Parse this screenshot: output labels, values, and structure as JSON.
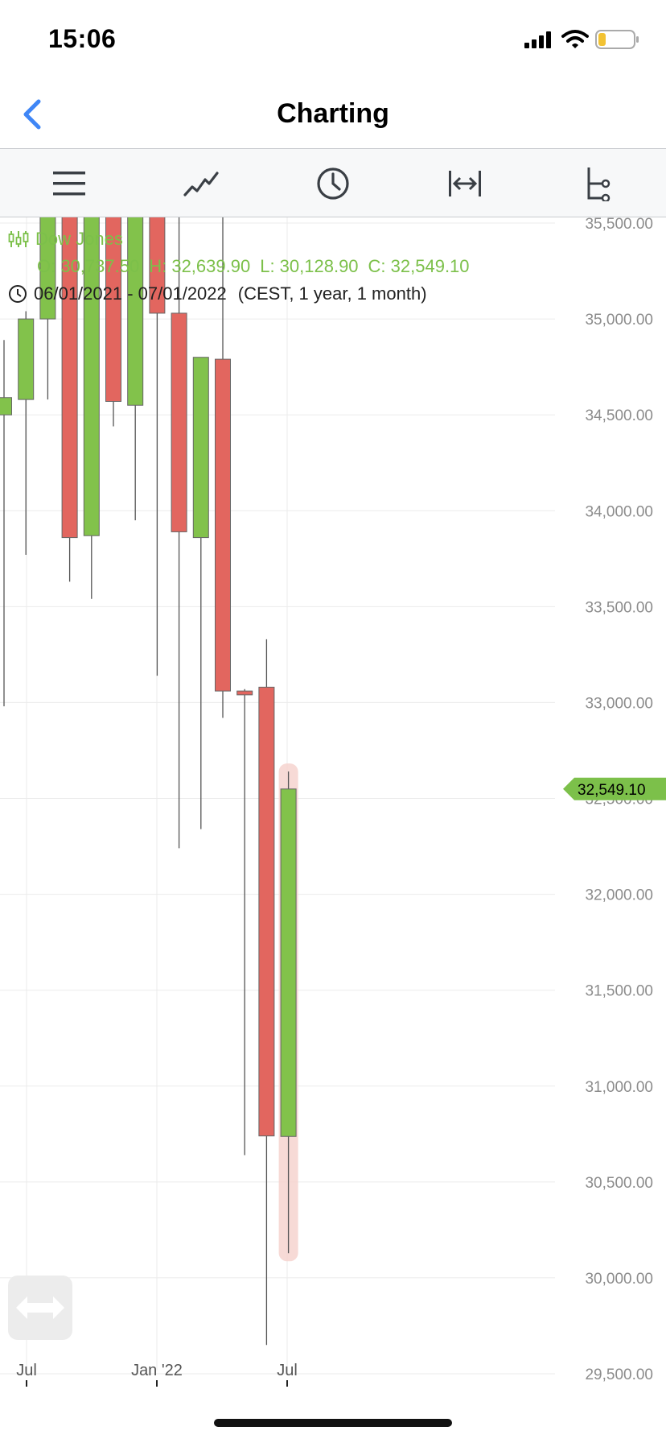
{
  "status": {
    "time": "15:06"
  },
  "nav": {
    "title": "Charting"
  },
  "toolbar": {
    "icons": [
      "menu-icon",
      "line-chart-icon",
      "clock-icon",
      "fit-width-icon",
      "hierarchy-icon"
    ]
  },
  "legend": {
    "name": "Dow Jones",
    "open": "O: 30,737.50",
    "high": "H: 32,639.90",
    "low": "L: 30,128.90",
    "close": "C: 32,549.10",
    "range": "06/01/2021 - 07/01/2022",
    "range_detail": "(CEST, 1 year, 1 month)"
  },
  "colors": {
    "up": "#82c24b",
    "down": "#e2665f",
    "accent": "#3f86f6",
    "last_price_bg": "#7cc04a"
  },
  "chart_data": {
    "type": "candlestick",
    "title": "Dow Jones",
    "ylim": [
      29500,
      35600
    ],
    "y_ticks": [
      35500,
      35000,
      34500,
      34000,
      33500,
      33000,
      32500,
      32000,
      31500,
      31000,
      30500,
      30000,
      29500
    ],
    "y_tick_labels": [
      "35,500.00",
      "35,000.00",
      "34,500.00",
      "34,000.00",
      "33,500.00",
      "33,000.00",
      "32,500.00",
      "32,000.00",
      "31,500.00",
      "31,000.00",
      "30,500.00",
      "30,000.00",
      "29,500.00"
    ],
    "x_tick_labels": [
      "Jul",
      "Jan '22",
      "Jul"
    ],
    "last_price": 32549.1,
    "last_price_label": "32,549.10",
    "candles": [
      {
        "o": 34500,
        "h": 34890,
        "l": 32980,
        "c": 34590
      },
      {
        "o": 34580,
        "h": 35040,
        "l": 33770,
        "c": 35000
      },
      {
        "o": 35000,
        "h": 35630,
        "l": 34580,
        "c": 35640
      },
      {
        "o": 35640,
        "h": 35650,
        "l": 33630,
        "c": 33860
      },
      {
        "o": 33870,
        "h": 35650,
        "l": 33540,
        "c": 35650
      },
      {
        "o": 35650,
        "h": 35650,
        "l": 34440,
        "c": 34570
      },
      {
        "o": 34550,
        "h": 35650,
        "l": 33950,
        "c": 35650
      },
      {
        "o": 35650,
        "h": 35650,
        "l": 33140,
        "c": 35030
      },
      {
        "o": 35030,
        "h": 35650,
        "l": 32240,
        "c": 33890
      },
      {
        "o": 33860,
        "h": 34790,
        "l": 32340,
        "c": 34800
      },
      {
        "o": 34790,
        "h": 35590,
        "l": 32920,
        "c": 33060
      },
      {
        "o": 33060,
        "h": 33070,
        "l": 30640,
        "c": 33040
      },
      {
        "o": 33080,
        "h": 33330,
        "l": 29650,
        "c": 30740
      },
      {
        "o": 30737.5,
        "h": 32639.9,
        "l": 30128.9,
        "c": 32549.1
      }
    ]
  }
}
